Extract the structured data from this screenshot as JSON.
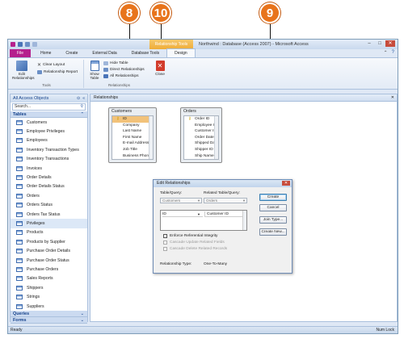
{
  "callouts": [
    "8",
    "10",
    "9"
  ],
  "title": {
    "context_tab": "Relationship Tools",
    "app_title": "Northwind : Database (Access 2007) - Microsoft Access"
  },
  "tabs": [
    "File",
    "Home",
    "Create",
    "External Data",
    "Database Tools",
    "Design"
  ],
  "ribbon": {
    "edit_relationships": "Edit\nRelationships",
    "clear_layout": "Clear Layout",
    "relationship_report": "Relationship Report",
    "tools_group": "Tools",
    "show_table": "Show\nTable",
    "hide_table": "Hide Table",
    "direct_relationships": "Direct Relationships",
    "all_relationships": "All Relationships",
    "relationships_group": "Relationships",
    "close": "Close"
  },
  "nav": {
    "header": "All Access Objects",
    "search_placeholder": "Search...",
    "tables_section": "Tables",
    "tables": [
      "Customers",
      "Employee Privileges",
      "Employees",
      "Inventory Transaction Types",
      "Inventory Transactions",
      "Invoices",
      "Order Details",
      "Order Details Status",
      "Orders",
      "Orders Status",
      "Orders Tax Status",
      "Privileges",
      "Products",
      "Products by Supplier",
      "Purchase Order Details",
      "Purchase Order Status",
      "Purchase Orders",
      "Sales Reports",
      "Shippers",
      "Strings",
      "Suppliers"
    ],
    "queries_section": "Queries",
    "forms_section": "Forms"
  },
  "document": {
    "tab_label": "Relationships",
    "customers_table": {
      "title": "Customers",
      "fields": [
        "ID",
        "Company",
        "Last Name",
        "First Name",
        "E-mail Address",
        "Job Title",
        "Business Phone"
      ]
    },
    "orders_table": {
      "title": "Orders",
      "fields": [
        "Order ID",
        "Employee ID",
        "Customer ID",
        "Order Date",
        "Shipped Date",
        "Shipper ID",
        "Ship Name"
      ]
    }
  },
  "dialog": {
    "title": "Edit Relationships",
    "table_query_label": "Table/Query:",
    "related_label": "Related Table/Query:",
    "table_value": "Customers",
    "related_value": "Orders",
    "left_field": "ID",
    "right_field": "Customer ID",
    "enforce": "Enforce Referential Integrity",
    "cascade_update": "Cascade Update Related Fields",
    "cascade_delete": "Cascade Delete Related Records",
    "relationship_type_label": "Relationship Type:",
    "relationship_type_value": "One-To-Many",
    "buttons": [
      "Create",
      "Cancel",
      "Join Type...",
      "Create New..."
    ]
  },
  "status": {
    "left": "Ready",
    "right": "Num Lock"
  },
  "colors": {
    "callout": "#e8741c",
    "file_tab": "#b5208d",
    "context_tab": "#efac37"
  }
}
